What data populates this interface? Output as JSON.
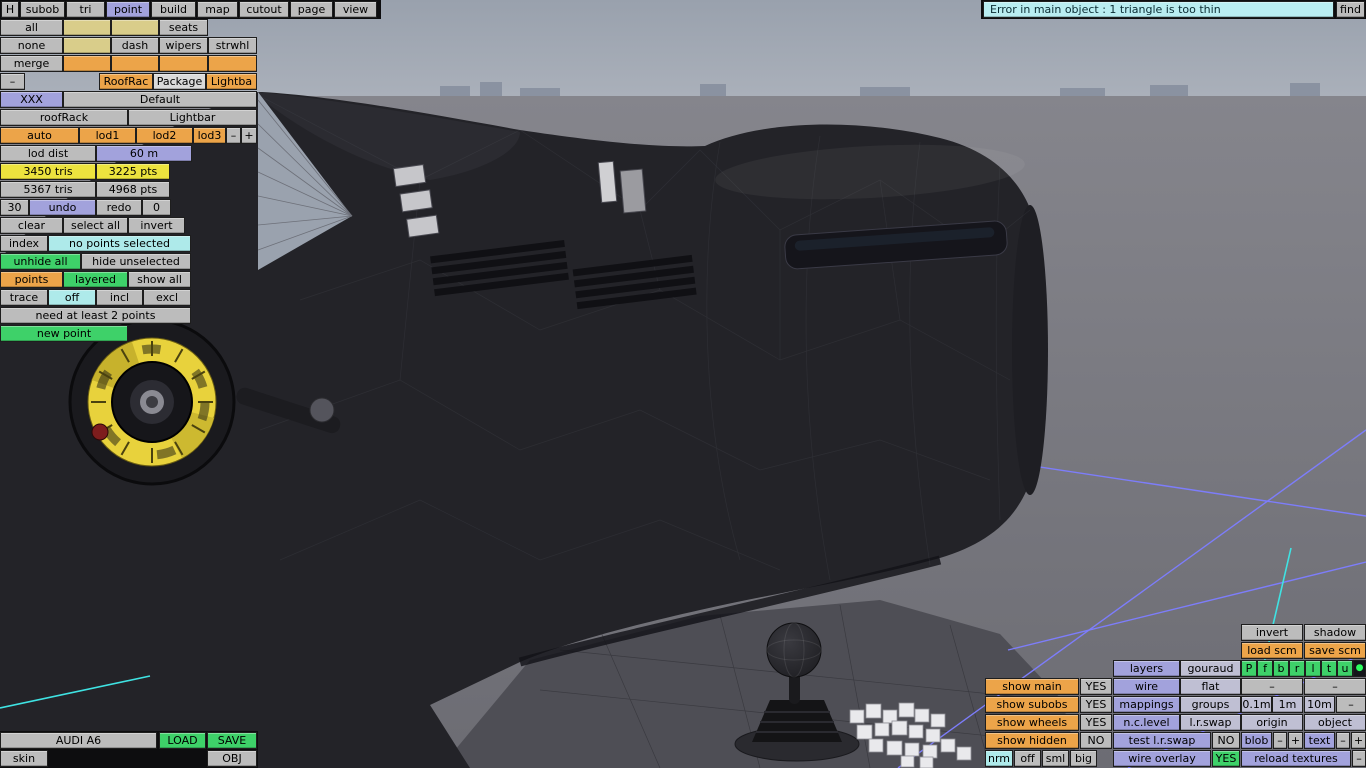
{
  "topbar": {
    "menu": [
      "H",
      "subob",
      "tri",
      "point",
      "build",
      "map",
      "cutout",
      "page",
      "view"
    ],
    "error_text": "Error in main object : 1 triangle is too thin",
    "find_label": "find"
  },
  "left": {
    "all": "all",
    "none": "none",
    "merge": "merge",
    "seats": "seats",
    "dash_btn": "dash",
    "wipers": "wipers",
    "strwhl": "strwhl",
    "minus": "–",
    "roofrac": "RoofRac",
    "package": "Package",
    "lightba": "Lightba",
    "xxx": "XXX",
    "default_name": "Default",
    "roofrack": "roofRack",
    "lightbar": "Lightbar",
    "auto": "auto",
    "lod1": "lod1",
    "lod2": "lod2",
    "lod3": "lod3",
    "lod_minus": "–",
    "lod_plus": "+",
    "lod_dist": "lod dist",
    "lod_dist_value": "60 m",
    "tris_lod": "3450 tris",
    "pts_lod": "3225 pts",
    "tris_total": "5367 tris",
    "pts_total": "4968 pts",
    "undo_count": "30",
    "undo": "undo",
    "redo": "redo",
    "redo_count": "0",
    "clear": "clear",
    "select_all": "select all",
    "invert": "invert",
    "index": "index",
    "selection_status": "no points selected",
    "unhide_all": "unhide all",
    "hide_unselected": "hide unselected",
    "points": "points",
    "layered": "layered",
    "show_all": "show all",
    "trace": "trace",
    "off": "off",
    "incl": "incl",
    "excl": "excl",
    "hint": "need at least 2 points",
    "new_point": "new point"
  },
  "bottom_left": {
    "model_name": "AUDI A6",
    "load": "LOAD",
    "save": "SAVE",
    "skin": "skin",
    "obj": "OBJ"
  },
  "right": {
    "invert": "invert",
    "shadow": "shadow",
    "load_scm": "load scm",
    "save_scm": "save scm",
    "proj": [
      "P",
      "f",
      "b",
      "r",
      "l",
      "t",
      "u"
    ],
    "indicator_dot": "●",
    "layers": "layers",
    "gouraud": "gouraud",
    "wire": "wire",
    "flat": "flat",
    "dash1": "–",
    "dash2": "–",
    "show_main": "show main",
    "show_main_value": "YES",
    "show_subobs": "show subobs",
    "show_subobs_value": "YES",
    "show_wheels": "show wheels",
    "show_wheels_value": "YES",
    "show_hidden": "show hidden",
    "show_hidden_value": "NO",
    "mappings": "mappings",
    "groups": "groups",
    "grid_01": "0.1m",
    "grid_1": "1m",
    "grid_10": "10m",
    "grid_minus": "–",
    "nc_level": "n.c.level",
    "lr_swap": "l.r.swap",
    "origin": "origin",
    "object": "object",
    "test_lr_swap": "test l.r.swap",
    "test_lr_swap_value": "NO",
    "blob": "blob",
    "blob_minus": "–",
    "blob_plus": "+",
    "text": "text",
    "text_minus": "–",
    "text_plus": "+",
    "nrm": "nrm",
    "off": "off",
    "sml": "sml",
    "big": "big",
    "wire_overlay": "wire overlay",
    "wire_overlay_value": "YES",
    "reload_textures": "reload textures",
    "reload_minus": "–"
  },
  "colors": {
    "accent_orange": "#eca449",
    "accent_purple": "#a2a2dc",
    "accent_cyan": "#aeeaea",
    "accent_green": "#3ed169",
    "accent_yellow": "#ece33e",
    "accent_tan": "#d9cd8a",
    "error_bg": "#b9edf1",
    "grid_blue": "#7d7dfb",
    "marker_cyan": "#3fe3e3",
    "gauge_yellow": "#e8d23c"
  }
}
